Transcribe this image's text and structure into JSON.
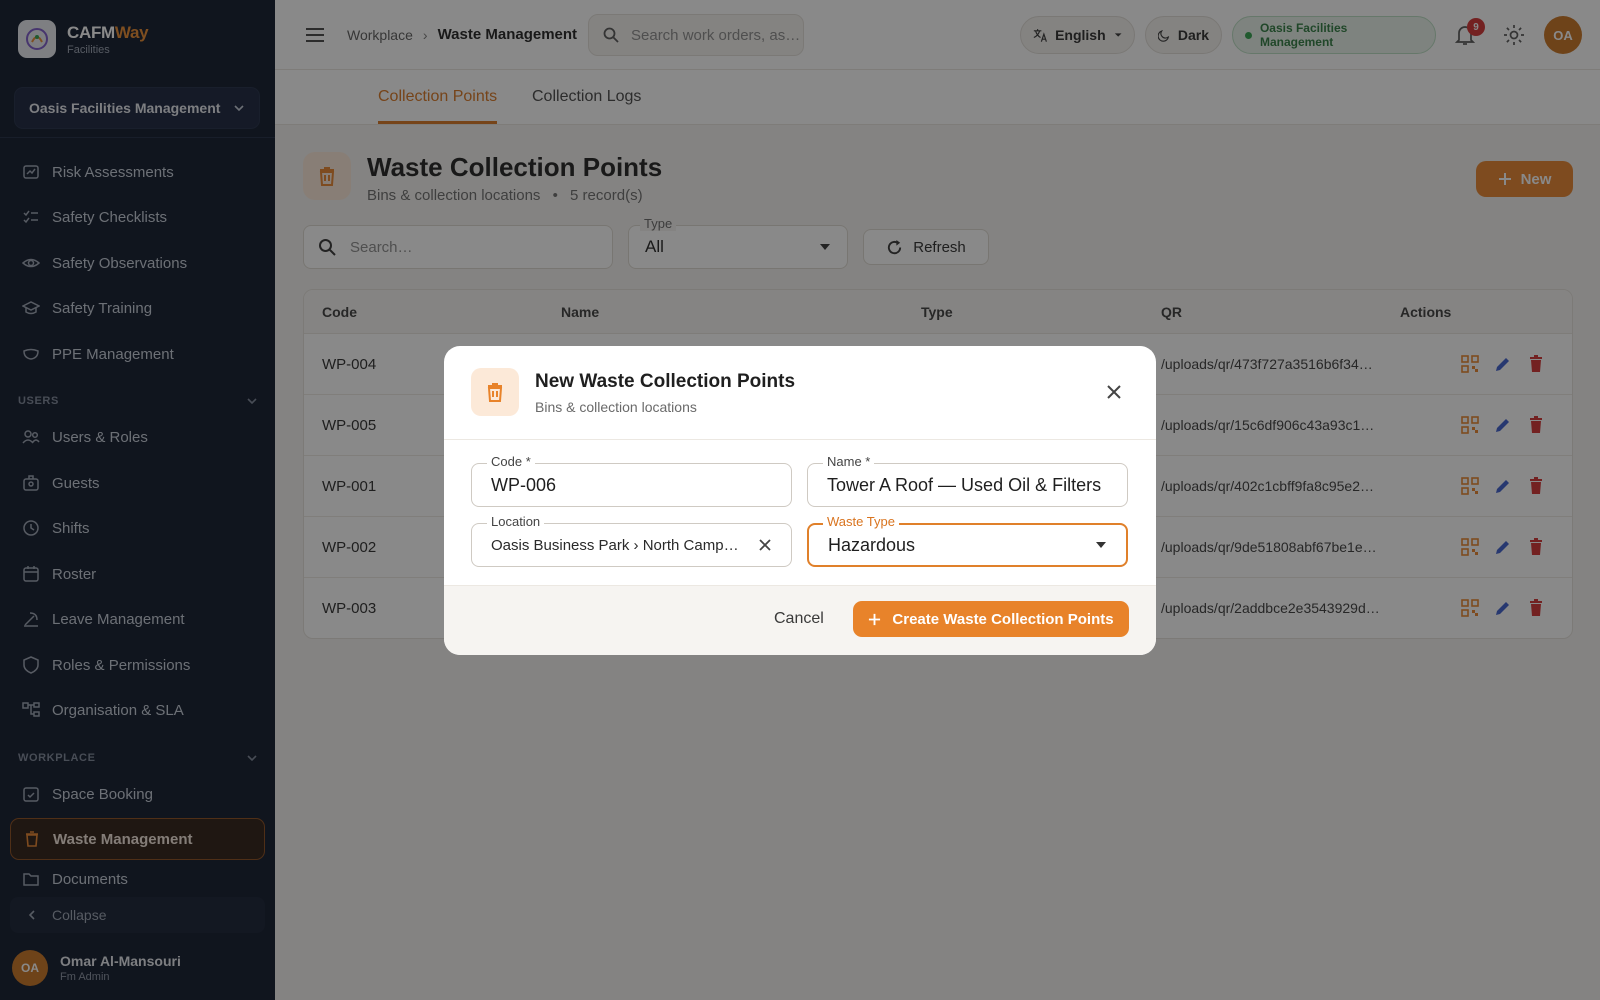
{
  "brand": {
    "name_part1": "CAFM",
    "name_part2": "Way",
    "subtitle": "Facilities"
  },
  "org_select": {
    "value": "Oasis Facilities Management"
  },
  "sidebar": {
    "items": [
      {
        "label": "Risk Assessments",
        "icon": "risk-assessment-icon"
      },
      {
        "label": "Safety Checklists",
        "icon": "checklist-icon"
      },
      {
        "label": "Safety Observations",
        "icon": "eye-icon"
      },
      {
        "label": "Safety Training",
        "icon": "graduation-cap-icon"
      },
      {
        "label": "PPE Management",
        "icon": "mask-icon"
      }
    ],
    "section_users": "USERS",
    "users_items": [
      {
        "label": "Users & Roles",
        "icon": "users-icon"
      },
      {
        "label": "Guests",
        "icon": "guest-icon"
      },
      {
        "label": "Shifts",
        "icon": "clock-icon"
      },
      {
        "label": "Roster",
        "icon": "calendar-icon"
      },
      {
        "label": "Leave Management",
        "icon": "leave-icon"
      },
      {
        "label": "Roles & Permissions",
        "icon": "shield-icon"
      },
      {
        "label": "Organisation & SLA",
        "icon": "org-chart-icon"
      }
    ],
    "section_workplace": "WORKPLACE",
    "workplace_items": [
      {
        "label": "Space Booking",
        "icon": "booking-icon"
      },
      {
        "label": "Waste Management",
        "icon": "trash-icon",
        "active": true
      },
      {
        "label": "Documents",
        "icon": "folder-icon"
      }
    ],
    "collapse_label": "Collapse"
  },
  "user": {
    "initials": "OA",
    "name": "Omar Al-Mansouri",
    "role": "Fm Admin"
  },
  "topbar": {
    "breadcrumb_parent": "Workplace",
    "breadcrumb_sep": "›",
    "breadcrumb_current": "Waste Management",
    "search_placeholder": "Search work orders, as…",
    "language": "English",
    "theme": "Dark",
    "org_status": "Oasis Facilities Management",
    "notification_count": "9",
    "avatar_initials": "OA"
  },
  "tabs": [
    {
      "label": "Collection Points",
      "active": true
    },
    {
      "label": "Collection Logs",
      "active": false
    }
  ],
  "page": {
    "title": "Waste Collection Points",
    "subtitle": "Bins & collection locations",
    "bullet": "•",
    "record_count": "5 record(s)",
    "new_button": "New"
  },
  "filters": {
    "search_placeholder": "Search…",
    "type_label": "Type",
    "type_value": "All",
    "refresh_button": "Refresh"
  },
  "table": {
    "headers": [
      "Code",
      "Name",
      "Type",
      "QR",
      "Actions"
    ],
    "rows": [
      {
        "code": "WP-004",
        "qr": "/uploads/qr/473f727a3516b6f34…"
      },
      {
        "code": "WP-005",
        "qr": "/uploads/qr/15c6df906c43a93c1…"
      },
      {
        "code": "WP-001",
        "qr": "/uploads/qr/402c1cbff9fa8c95e2…"
      },
      {
        "code": "WP-002",
        "qr": "/uploads/qr/9de51808abf67be1e…"
      },
      {
        "code": "WP-003",
        "qr": "/uploads/qr/2addbce2e3543929d…"
      }
    ]
  },
  "modal": {
    "title": "New Waste Collection Points",
    "subtitle": "Bins & collection locations",
    "code_label": "Code *",
    "code_value": "WP-006",
    "name_label": "Name *",
    "name_value": "Tower A Roof — Used Oil & Filters",
    "location_label": "Location",
    "location_value": "Oasis Business Park › North Campus › Tower A",
    "waste_type_label": "Waste Type",
    "waste_type_value": "Hazardous",
    "cancel_button": "Cancel",
    "create_button": "Create Waste Collection Points"
  },
  "colors": {
    "accent": "#e8832a",
    "sidebar_bg": "#0d1628",
    "danger": "#d32f2f",
    "edit": "#3b5ccc"
  }
}
